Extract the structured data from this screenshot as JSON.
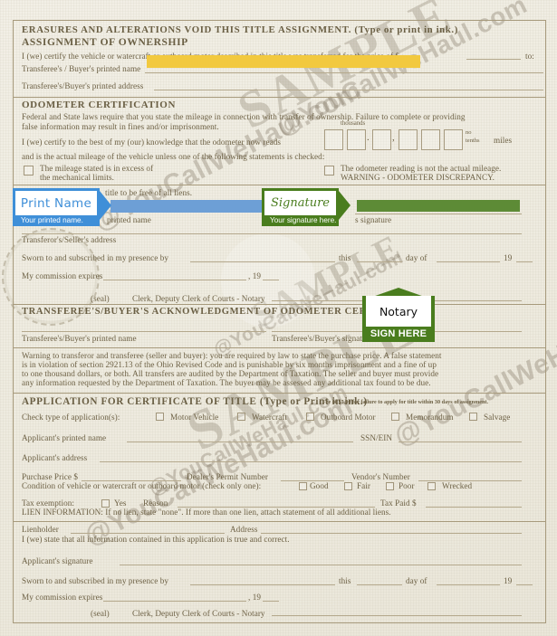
{
  "document": {
    "type": "vehicle-title-assignment-form",
    "state_reference": "Ohio Revised Code"
  },
  "watermarks": {
    "sample_text": "SAMPLE",
    "url_text": "@YouCallWeHaul.com"
  },
  "assignment": {
    "heading_line1": "ERASURES AND ALTERATIONS VOID THIS TITLE ASSIGNMENT. (Type or print in ink.)",
    "heading_line2": "ASSIGNMENT OF OWNERSHIP",
    "certify_text": "I (we) certify the vehicle or watercraft or outboard motor described in this title was transferred for the price of $",
    "certify_tail": "to:",
    "buyer_name_label": "Transferee's / Buyer's printed name",
    "buyer_address_label": "Transferee's/Buyer's printed address"
  },
  "odometer": {
    "heading": "ODOMETER CERTIFICATION",
    "federal_line1": "Federal and State laws require that you state the mileage in connection with transfer of ownership. Failure to complete or providing",
    "federal_line2": "false information may result in fines and/or imprisonment.",
    "certify_line1": "I (we) certify to the best of my (our) knowledge that the odometer now reads",
    "certify_line2": "and is the actual mileage of the vehicle unless one of the following statements is checked:",
    "thousands_label": "thousands",
    "no_tenths_label_1": "no",
    "no_tenths_label_2": "tenths",
    "miles_label": "miles",
    "digit_box_count": 6,
    "checkbox_left_line1": "The mileage stated is in excess of",
    "checkbox_left_line2": "the mechanical limits.",
    "checkbox_right_line1": "The odometer reading is not the actual mileage.",
    "checkbox_right_line2": "WARNING - ODOMETER DISCREPANCY."
  },
  "seller_block": {
    "lien_text": "title to be free of all liens.",
    "printed_name_label": "printed name",
    "signature_label": "s signature",
    "address_label": "Transferor's/Seller's address",
    "sworn_label": "Sworn to and subscribed in my presence by",
    "this_label": "this",
    "day_of_label": "day of",
    "year_prefix": "19",
    "commission_label": "My commission expires",
    "commission_year": ", 19",
    "seal_label": "(seal)",
    "clerk_label": "Clerk, Deputy Clerk of Courts - Notary"
  },
  "acknowledgment": {
    "heading": "TRANSFEREE'S/BUYER'S ACKNOWLEDGMENT OF ODOMETER CERTIFICATION",
    "printed_name_label": "Transferee's/Buyer's printed name",
    "signature_label": "Transferee's/Buyer's signature",
    "warning_line1": "Warning to transferor and transferee (seller and buyer): you are required by law to state the purchase price. A false statement",
    "warning_line2": "is in violation of section 2921.13 of the Ohio Revised Code and is punishable by six months imprisonment and a fine of up",
    "warning_line3": "to one thousand dollars, or both. All transfers are audited by the Department of Taxation. The seller and buyer must provide",
    "warning_line4": "any information requested by the Department of Taxation. The buyer may be assessed any additional tax found to be due."
  },
  "application": {
    "heading": "APPLICATION FOR CERTIFICATE OF TITLE (Type or Print in ink.)",
    "fee_note": "Fee of $5.00 for failure to apply for title within 30 days of assignment.",
    "check_type_label": "Check type of application(s):",
    "type_options": [
      "Motor Vehicle",
      "Watercraft",
      "Outboard Motor",
      "Memorandum",
      "Salvage"
    ],
    "applicant_name_label": "Applicant's printed name",
    "ssn_label": "SSN/EIN",
    "applicant_address_label": "Applicant's address",
    "purchase_price_label": "Purchase Price $",
    "dealer_permit_label": "Dealer's Permit Number",
    "vendor_number_label": "Vendor's Number",
    "condition_label": "Condition of vehicle or watercraft or outboard motor (check only one):",
    "condition_options": [
      "Good",
      "Fair",
      "Poor",
      "Wrecked"
    ],
    "tax_exemption_label": "Tax exemption:",
    "tax_exemption_yes": "Yes",
    "reason_label": "Reason",
    "tax_paid_label": "Tax Paid $",
    "lien_info": "LIEN INFORMATION: If no lien, state \"none\". If more than one lien, attach statement of all additional liens.",
    "lienholder_label": "Lienholder",
    "address_label": "Address",
    "truth_statement": "I (we) state that all information contained in this application is true and correct.",
    "applicant_signature_label": "Applicant's signature",
    "sworn_label": "Sworn to and subscribed in my presence by",
    "this_label": "this",
    "day_of_label": "day of",
    "year_prefix": "19",
    "commission_label": "My commission expires",
    "commission_year": ", 19",
    "seal_label": "(seal)",
    "clerk_label": "Clerk, Deputy Clerk of Courts - Notary"
  },
  "callouts": {
    "print_name": {
      "title": "Print Name",
      "caption": "Your printed name.",
      "color": "#3f8fd8"
    },
    "signature": {
      "title": "Signature",
      "caption": "Your signature here.",
      "color": "#4a7d1e"
    },
    "notary": {
      "title": "Notary",
      "caption": "SIGN HERE",
      "color": "#4a7d1e"
    }
  },
  "highlights": {
    "buyer_name_color": "#f2c93f",
    "seller_name_color": "#6d9fd6",
    "seller_signature_color": "#5d8b36"
  }
}
